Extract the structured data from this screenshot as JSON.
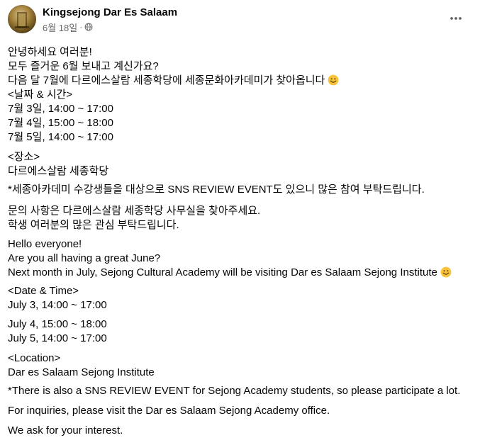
{
  "post": {
    "author": "Kingsejong Dar Es Salaam",
    "timestamp": "6월 18일",
    "separator": "·",
    "audience_icon": "globe-icon",
    "more_icon": "more-options-icon",
    "emoji_icon": "smiley-face-icon"
  },
  "content": {
    "ko_greeting": [
      "안녕하세요 여러분!",
      "모두 즐거운 6월 보내고 계신가요?",
      "다음 달 7월에 다르에스살람 세종학당에 세종문화아카데미가 찾아옵니다"
    ],
    "ko_date_header": "<날짜 & 시간>",
    "ko_dates": [
      "7월 3일, 14:00 ~ 17:00",
      "7월 4일, 15:00 ~ 18:00",
      "7월 5일, 14:00 ~ 17:00"
    ],
    "ko_location_header": "<장소>",
    "ko_location": "다르에스살람 세종학당",
    "ko_event": "*세종아카데미 수강생들을 대상으로 SNS REVIEW EVENT도 있으니 많은 참여 부탁드립니다.",
    "ko_inquiry": [
      "문의 사항은 다르에스살람 세종학당 사무실을 찾아주세요.",
      "학생 여러분의 많은 관심 부탁드립니다."
    ],
    "en_greeting": [
      "Hello everyone!",
      "Are you all having a great June?",
      "Next month in July, Sejong Cultural Academy will be visiting Dar es Salaam Sejong Institute"
    ],
    "en_date_header": "<Date & Time>",
    "en_date_1": "July 3, 14:00 ~ 17:00",
    "en_dates_rest": [
      "July 4, 15:00 ~ 18:00",
      "July 5, 14:00 ~ 17:00"
    ],
    "en_location_header": "<Location>",
    "en_location": "Dar es Salaam Sejong Institute",
    "en_event": "*There is also a SNS REVIEW EVENT for Sejong Academy students, so please participate a lot.",
    "en_inquiry": "For inquiries, please visit the Dar es Salaam Sejong Academy office.",
    "en_interest": "We ask for your interest."
  }
}
